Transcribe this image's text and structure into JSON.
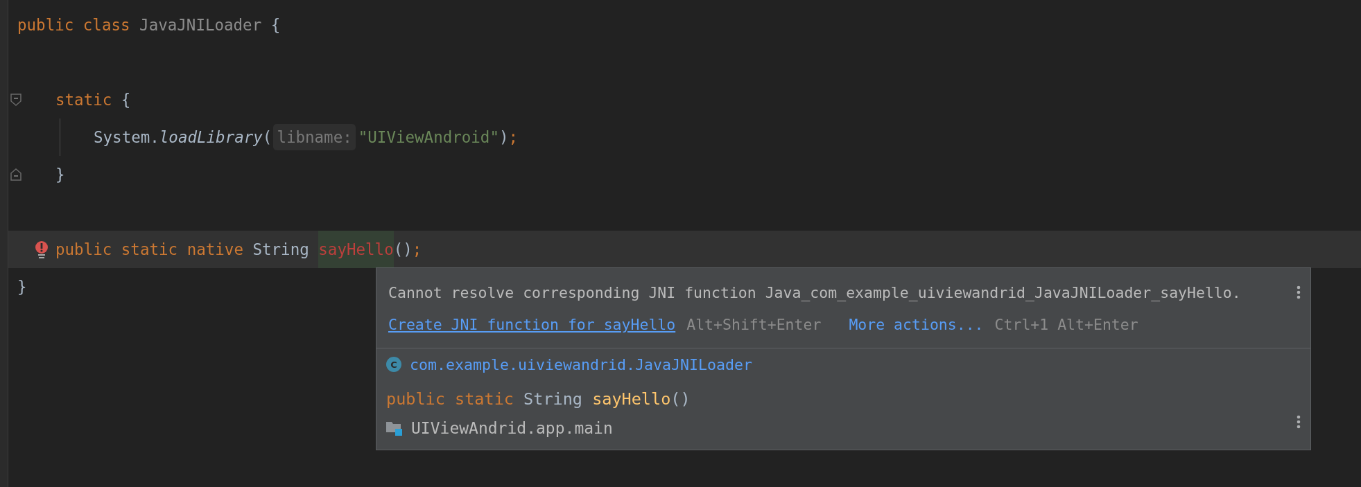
{
  "editor": {
    "lines": [
      {
        "kind": "code",
        "highlighted": false,
        "tokens": [
          {
            "text": "public",
            "kind": "keyword"
          },
          {
            "text": " class",
            "kind": "keyword"
          },
          {
            "text": " JavaJNILoader",
            "kind": "unused"
          },
          {
            "text": " {",
            "kind": "plain"
          }
        ],
        "children": [
          {
            "kind": "blank",
            "highlighted": false
          },
          {
            "kind": "fold-start",
            "highlighted": false,
            "tokens": [
              {
                "text": "static",
                "kind": "keyword"
              },
              {
                "text": " {",
                "kind": "plain"
              }
            ],
            "children": [
              {
                "kind": "code",
                "highlighted": false,
                "guide": true,
                "tokens": [
                  {
                    "text": "System.",
                    "kind": "plain"
                  },
                  {
                    "text": "loadLibrary",
                    "kind": "static-call"
                  },
                  {
                    "text": "(",
                    "kind": "plain"
                  },
                  {
                    "text": "libname:",
                    "kind": "hint"
                  },
                  {
                    "text": "\"UIViewAndroid\"",
                    "kind": "string"
                  },
                  {
                    "text": ")",
                    "kind": "plain"
                  },
                  {
                    "text": ";",
                    "kind": "keyword"
                  }
                ]
              }
            ]
          },
          {
            "kind": "fold-end",
            "highlighted": false,
            "tokens": [
              {
                "text": "}",
                "kind": "plain"
              }
            ]
          },
          {
            "kind": "blank",
            "highlighted": false
          },
          {
            "kind": "error",
            "highlighted": true,
            "tokens": [
              {
                "text": "public",
                "kind": "keyword"
              },
              {
                "text": " static",
                "kind": "keyword"
              },
              {
                "text": " native",
                "kind": "keyword"
              },
              {
                "text": " String ",
                "kind": "plain"
              },
              {
                "text": "sayHello",
                "kind": "error"
              },
              {
                "text": "()",
                "kind": "plain"
              },
              {
                "text": ";",
                "kind": "keyword"
              }
            ]
          }
        ]
      },
      {
        "kind": "code",
        "highlighted": false,
        "tokens": [
          {
            "text": "}",
            "kind": "plain"
          }
        ]
      }
    ]
  },
  "popup": {
    "message": "Cannot resolve corresponding JNI function Java_com_example_uiviewandrid_JavaJNILoader_sayHello.",
    "actions": [
      {
        "label": "Create JNI function for sayHello",
        "shortcut": "Alt+Shift+Enter",
        "kind": "fix"
      },
      {
        "label": "More actions...",
        "shortcut": "Ctrl+1 Alt+Enter",
        "kind": "more"
      }
    ],
    "class_ref": {
      "badge": "C",
      "name": "com.example.uiviewandrid.JavaJNILoader"
    },
    "signature": [
      {
        "text": "public",
        "kind": "keyword"
      },
      {
        "text": " static",
        "kind": "keyword"
      },
      {
        "text": " String ",
        "kind": "plain"
      },
      {
        "text": "sayHello",
        "kind": "method"
      },
      {
        "text": "()",
        "kind": "plain"
      }
    ],
    "module": "UIViewAndrid.app.main"
  }
}
